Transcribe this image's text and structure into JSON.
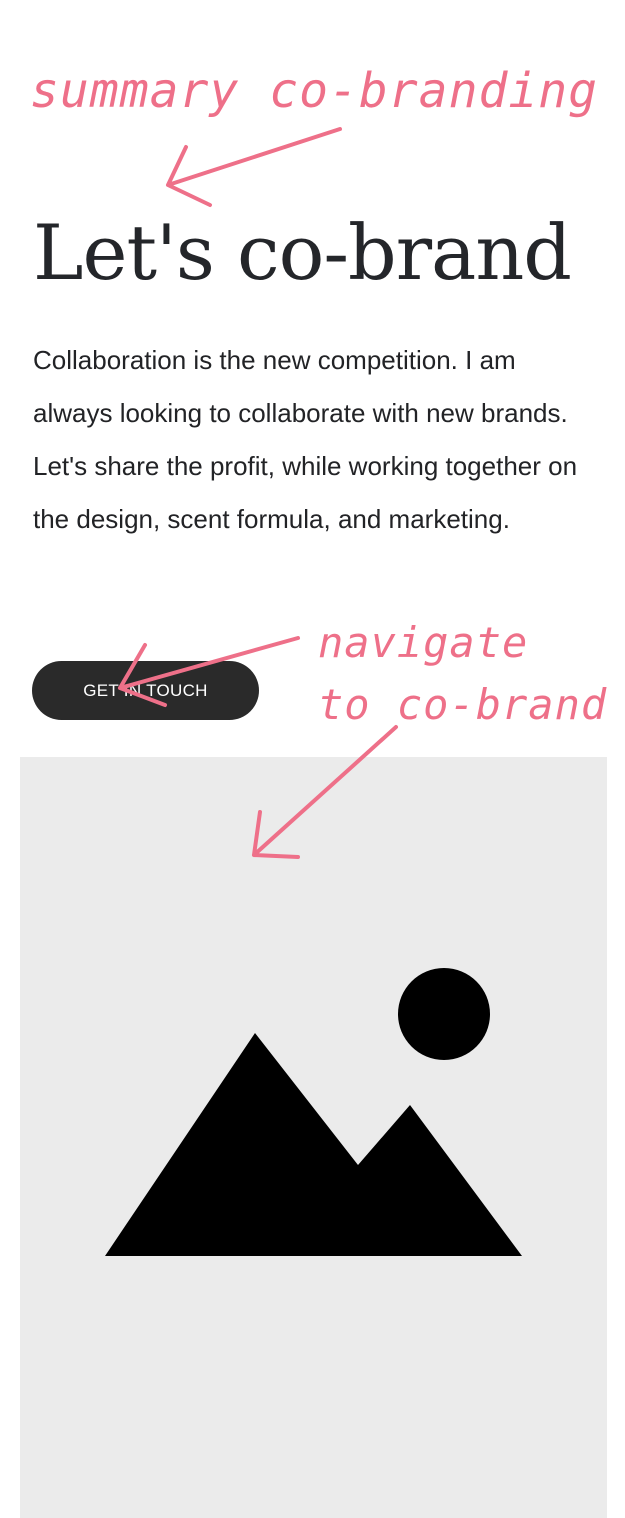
{
  "annotations": {
    "summary": "summary co-branding",
    "navigate_line1": "navigate",
    "navigate_line2": "to co-brand"
  },
  "section": {
    "title": "Let's co-brand",
    "body": "Collaboration is the new competition. I am always looking to collaborate with new brands. Let's share the profit, while working together on the design, scent formula,  and marketing.",
    "cta_label": "GET IN TOUCH"
  },
  "image": {
    "icon": "image-placeholder-icon"
  },
  "colors": {
    "annotation": "#ee7089",
    "button_background": "#2a2a2a",
    "button_text": "#ffffff",
    "placeholder_background": "#ebebeb",
    "heading_text": "#24262a"
  }
}
